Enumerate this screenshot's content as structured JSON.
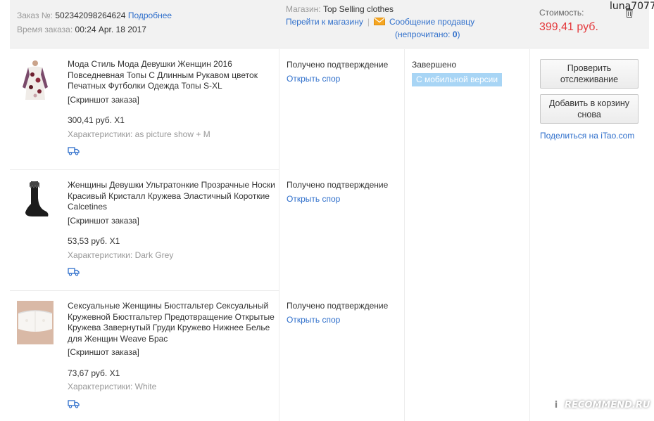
{
  "header": {
    "order_label": "Заказ №:",
    "order_number": "502342098264624",
    "details_link": "Подробнее",
    "time_label": "Время заказа:",
    "time_value": "00:24 Apr. 18 2017",
    "store_label": "Магазин:",
    "store_name": "Top Selling clothes",
    "goto_store": "Перейти к магазину",
    "message_seller": "Сообщение продавцу",
    "unread_prefix": "(непрочитано: ",
    "unread_count": "0",
    "unread_suffix": ")",
    "cost_label": "Стоимость:",
    "cost_value": "399,41 руб."
  },
  "watermark": {
    "user": "luna7077",
    "site": "RECOMMEND.RU",
    "badge": "i"
  },
  "items": [
    {
      "title": "Мода Стиль Мода Девушки Женщин 2016 Повседневная Топы С Длинным Рукавом цветок Печатных Футболки Одежда Топы S-XL",
      "snapshot": "[Скриншот заказа]",
      "price": "300,41 руб. X1",
      "props": "Характеристики: as picture show + M",
      "status": "Получено подтверждение",
      "dispute": "Открыть спор"
    },
    {
      "title": "Женщины Девушки Ультратонкие Прозрачные Носки Красивый Кристалл Кружева Эластичный Короткие Calcetines",
      "snapshot": "[Скриншот заказа]",
      "price": "53,53 руб. X1",
      "props": "Характеристики: Dark Grey",
      "status": "Получено подтверждение",
      "dispute": "Открыть спор"
    },
    {
      "title": "Сексуальные Женщины Бюстгальтер Сексуальный Кружевной Бюстгальтер Предотвращение Открытые Кружева Завернутый Груди Кружево Нижнее Белье для Женщин Weave Брас",
      "snapshot": "[Скриншот заказа]",
      "price": "73,67 руб. X1",
      "props": "Характеристики: White",
      "status": "Получено подтверждение",
      "dispute": "Открыть спор"
    }
  ],
  "order_status": {
    "final": "Завершено",
    "badge": "С мобильной версии"
  },
  "actions": {
    "track": "Проверить отслеживание",
    "add_cart": "Добавить в корзину снова",
    "share_prefix": "Поделиться на ",
    "share_site": "iTao.com"
  },
  "colors": {
    "link": "#2f6fcb",
    "price_red": "#e4393c",
    "badge_blue": "#a8d5f5"
  }
}
